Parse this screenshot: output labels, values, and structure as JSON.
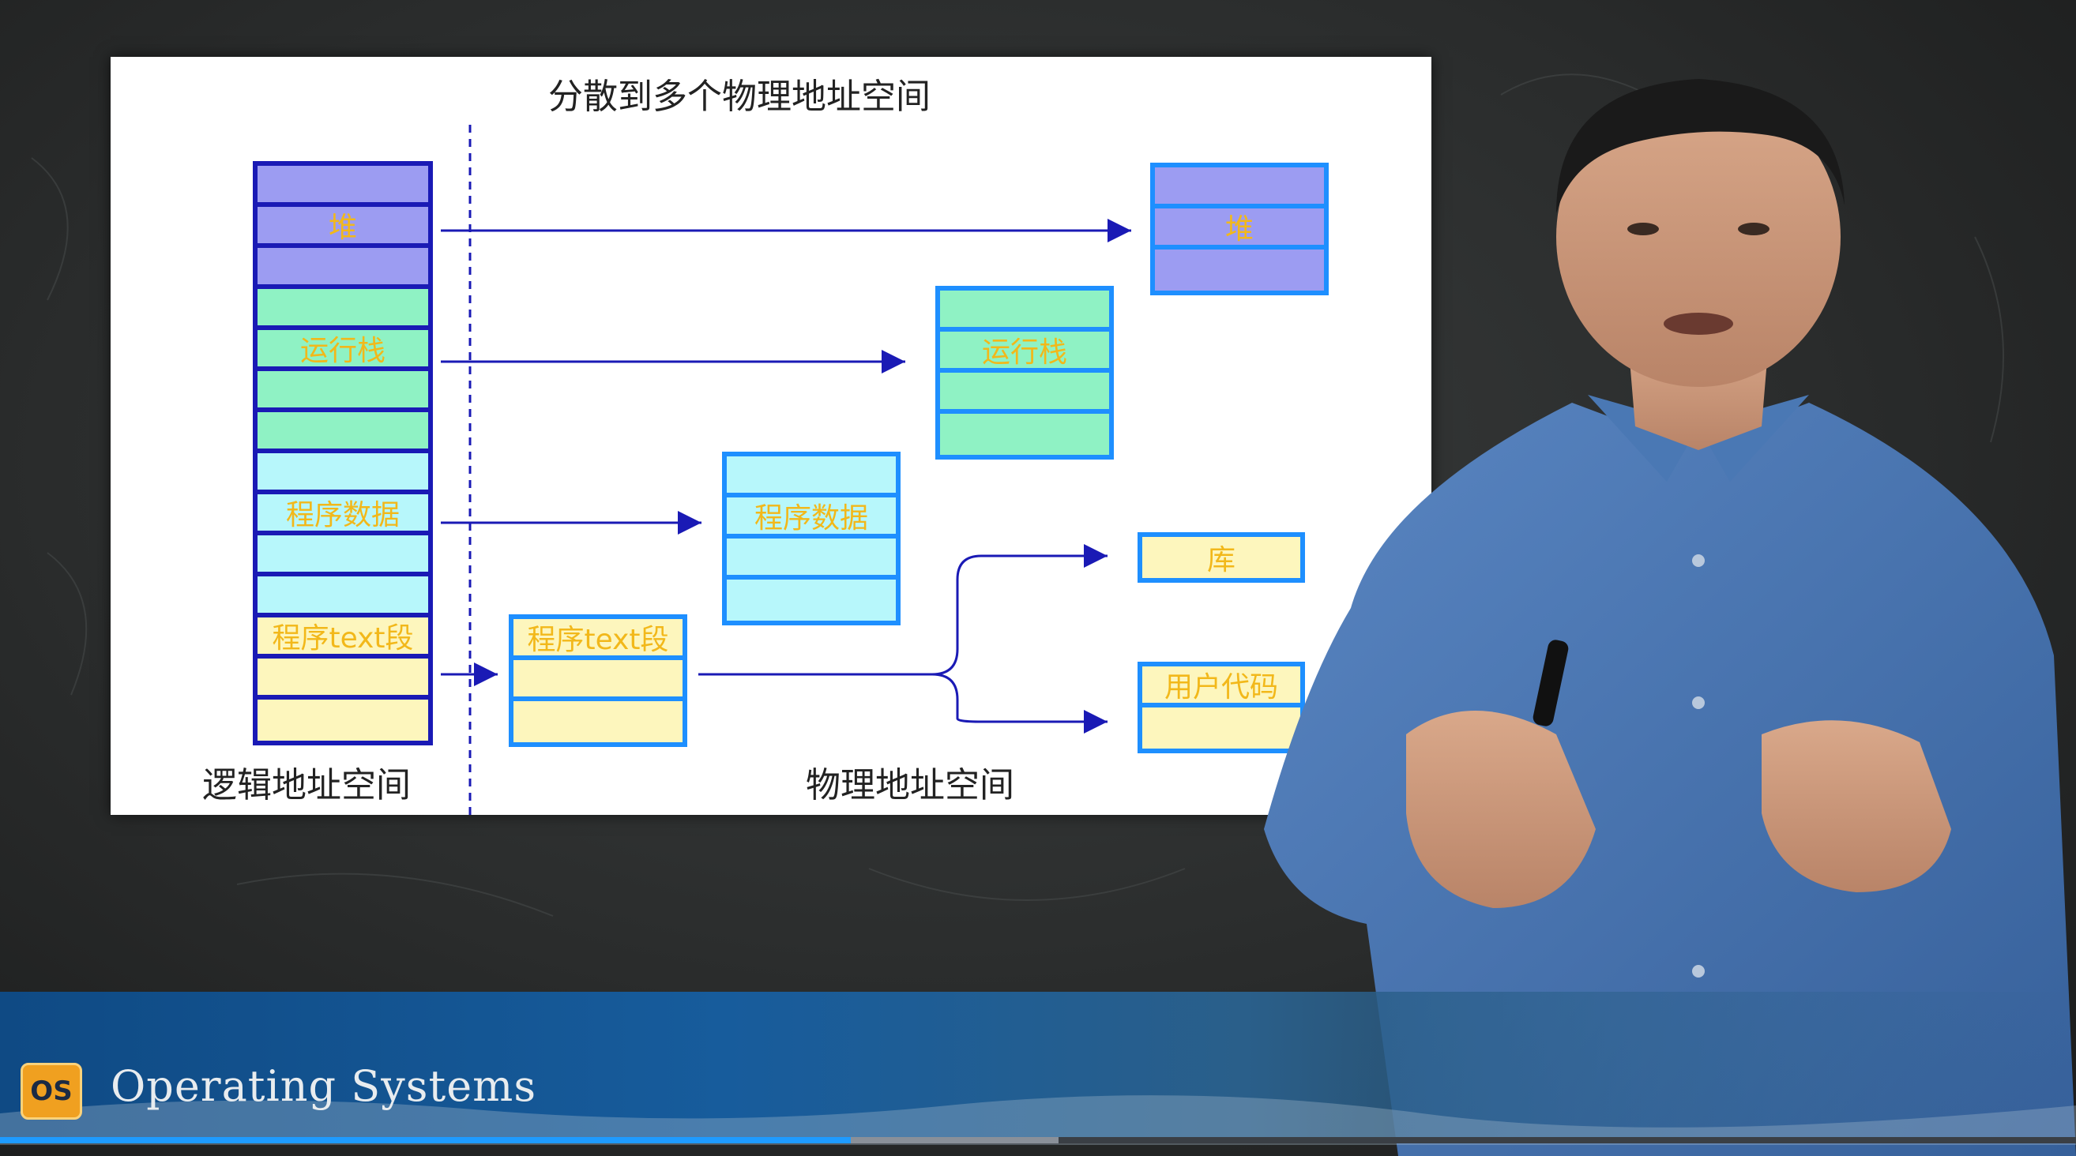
{
  "slide": {
    "title": "分散到多个物理地址空间",
    "logical_label": "逻辑地址空间",
    "physical_label": "物理地址空间"
  },
  "logical_stack": [
    {
      "kind": "heap",
      "label": ""
    },
    {
      "kind": "heap",
      "label": "堆"
    },
    {
      "kind": "heap",
      "label": ""
    },
    {
      "kind": "stack",
      "label": ""
    },
    {
      "kind": "stack",
      "label": "运行栈"
    },
    {
      "kind": "stack",
      "label": ""
    },
    {
      "kind": "stack",
      "label": ""
    },
    {
      "kind": "data",
      "label": ""
    },
    {
      "kind": "data",
      "label": "程序数据"
    },
    {
      "kind": "data",
      "label": ""
    },
    {
      "kind": "data",
      "label": ""
    },
    {
      "kind": "text",
      "label": "程序text段"
    },
    {
      "kind": "text",
      "label": ""
    },
    {
      "kind": "text",
      "label": ""
    }
  ],
  "physical_blocks": {
    "heap": [
      "",
      "堆",
      ""
    ],
    "stack": [
      "",
      "运行栈",
      "",
      ""
    ],
    "data": [
      "",
      "程序数据",
      "",
      ""
    ],
    "text": [
      "程序text段",
      "",
      ""
    ],
    "lib": [
      "库"
    ],
    "user_code": [
      "用户代码",
      ""
    ]
  },
  "banner": {
    "logo": "OS",
    "course": "Operating Systems"
  },
  "colors": {
    "heap": "#9c9cf2",
    "stack": "#8ff2c4",
    "data": "#b7f7fb",
    "text": "#fdf6bd",
    "logical_border": "#1a1ab5",
    "physical_border": "#1e8fff",
    "label": "#f2b81a"
  },
  "video": {
    "progress_played": 0.41,
    "progress_buffered": 0.51
  }
}
